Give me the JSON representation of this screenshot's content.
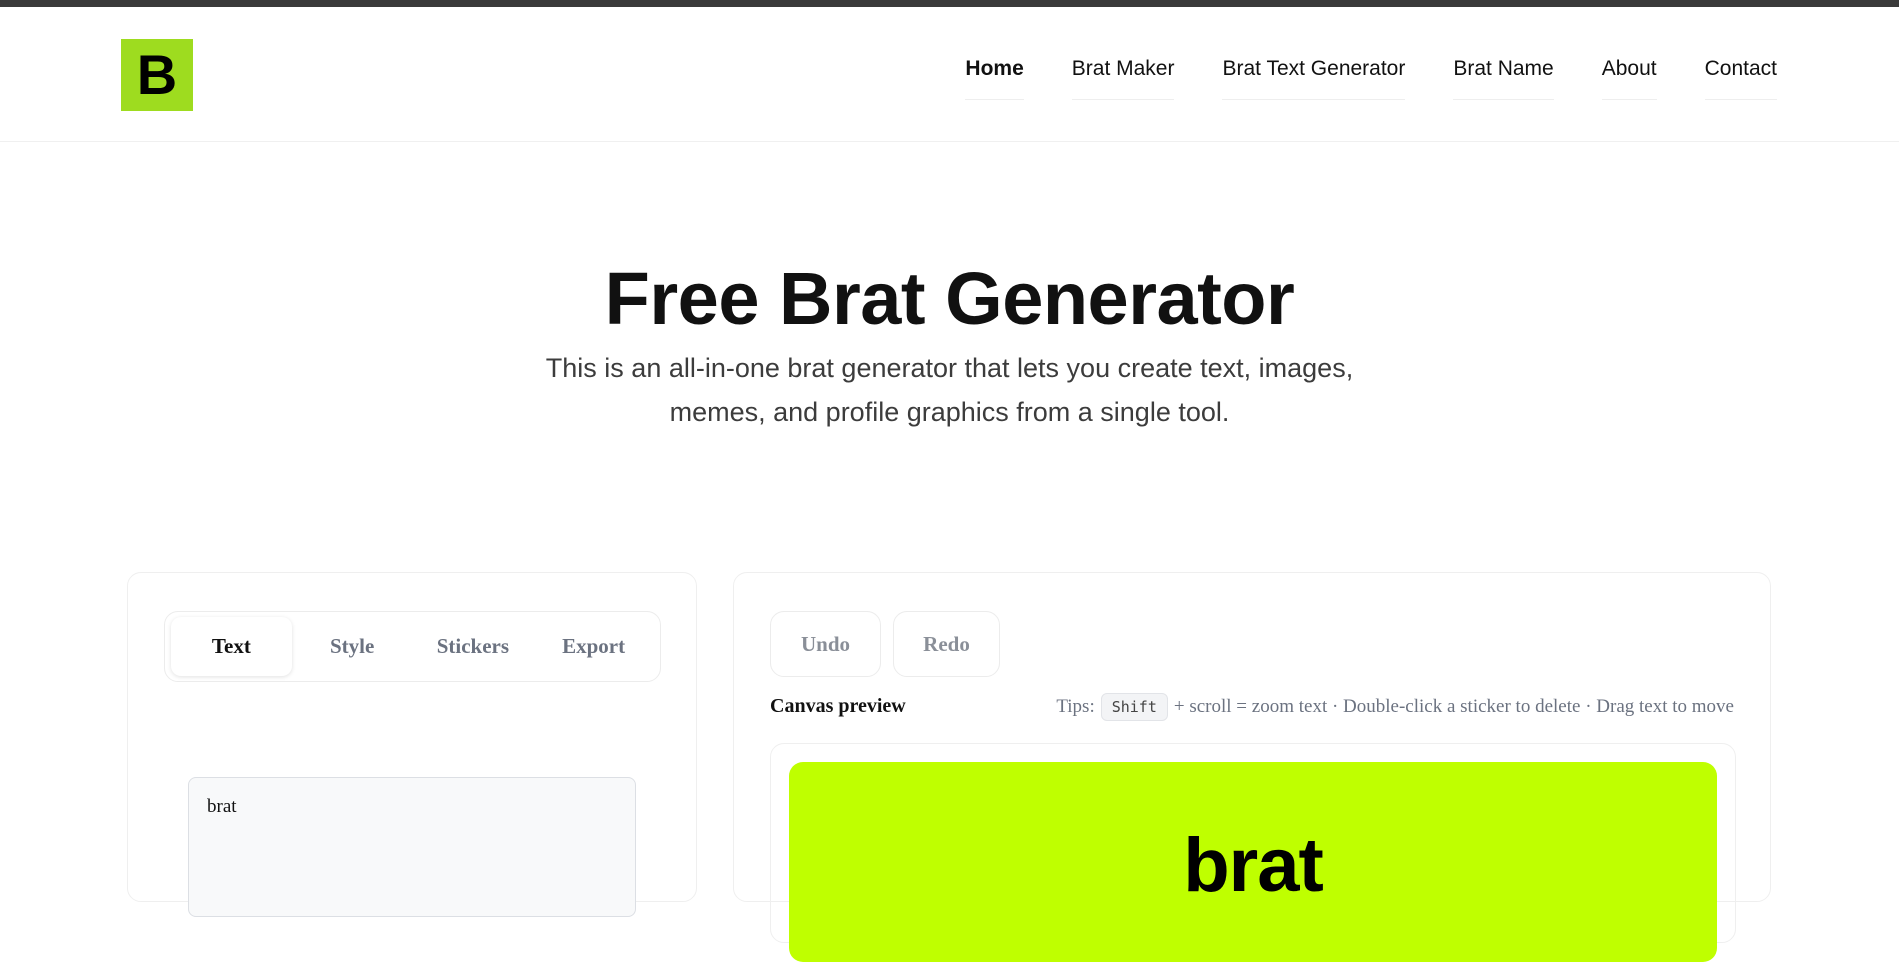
{
  "header": {
    "logo_letter": "B",
    "nav": [
      {
        "label": "Home",
        "active": true
      },
      {
        "label": "Brat Maker",
        "active": false
      },
      {
        "label": "Brat Text Generator",
        "active": false
      },
      {
        "label": "Brat Name",
        "active": false
      },
      {
        "label": "About",
        "active": false
      },
      {
        "label": "Contact",
        "active": false
      }
    ]
  },
  "hero": {
    "title": "Free Brat Generator",
    "subtitle": "This is an all-in-one brat generator that lets you create text, images, memes, and profile graphics from a single tool."
  },
  "editor": {
    "tabs": [
      {
        "label": "Text",
        "active": true
      },
      {
        "label": "Style",
        "active": false
      },
      {
        "label": "Stickers",
        "active": false
      },
      {
        "label": "Export",
        "active": false
      }
    ],
    "text_value": "brat"
  },
  "preview": {
    "undo_label": "Undo",
    "redo_label": "Redo",
    "label": "Canvas preview",
    "tips_prefix": "Tips:",
    "tips_key": "Shift",
    "tips_rest": "+ scroll = zoom text · Double-click a sticker to delete · Drag text to move",
    "canvas_text": "brat",
    "canvas_color": "#bfff00"
  },
  "colors": {
    "logo_bg": "#9edc1f",
    "canvas_bg": "#bfff00",
    "text_primary": "#111111",
    "tab_inactive": "#6b7280"
  }
}
